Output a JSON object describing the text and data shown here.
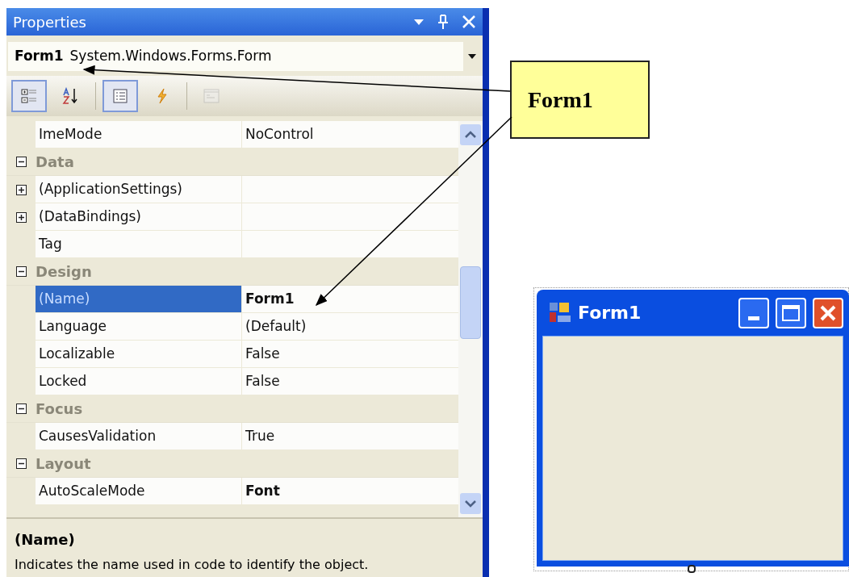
{
  "panel": {
    "title": "Properties"
  },
  "object_selector": {
    "name": "Form1",
    "type": "System.Windows.Forms.Form"
  },
  "toolbar": [
    {
      "kind": "categorized",
      "selected": true,
      "disabled": false
    },
    {
      "kind": "alphabetical",
      "selected": false,
      "disabled": false
    },
    {
      "kind": "separator"
    },
    {
      "kind": "properties",
      "selected": true,
      "disabled": false
    },
    {
      "kind": "events",
      "selected": false,
      "disabled": false
    },
    {
      "kind": "separator"
    },
    {
      "kind": "pages",
      "selected": false,
      "disabled": true
    }
  ],
  "rows": [
    {
      "kind": "property",
      "name": "ImeMode",
      "value": "NoControl",
      "selected": false,
      "bold": false
    },
    {
      "kind": "category",
      "name": "Data",
      "expanded": true
    },
    {
      "kind": "property",
      "name": "(ApplicationSettings)",
      "selected": false,
      "expanded": false
    },
    {
      "kind": "property",
      "name": "(DataBindings)",
      "selected": false,
      "expanded": false
    },
    {
      "kind": "property",
      "name": "Tag",
      "selected": false
    },
    {
      "kind": "category",
      "name": "Design",
      "expanded": true
    },
    {
      "kind": "property",
      "name": "(Name)",
      "value": "Form1",
      "selected": true,
      "bold": true
    },
    {
      "kind": "property",
      "name": "Language",
      "value": "(Default)",
      "selected": false,
      "bold": false
    },
    {
      "kind": "property",
      "name": "Localizable",
      "value": "False",
      "selected": false,
      "bold": false
    },
    {
      "kind": "property",
      "name": "Locked",
      "value": "False",
      "selected": false,
      "bold": false
    },
    {
      "kind": "category",
      "name": "Focus",
      "expanded": true
    },
    {
      "kind": "property",
      "name": "CausesValidation",
      "value": "True",
      "selected": false,
      "bold": false
    },
    {
      "kind": "category",
      "name": "Layout",
      "expanded": true
    },
    {
      "kind": "property",
      "name": "AutoScaleMode",
      "value": "Font",
      "selected": false,
      "bold": true
    }
  ],
  "description": {
    "title": "(Name)",
    "text": "Indicates the name used in code to identify the object."
  },
  "callout": {
    "text": "Form1"
  },
  "form_window": {
    "title": "Form1"
  }
}
